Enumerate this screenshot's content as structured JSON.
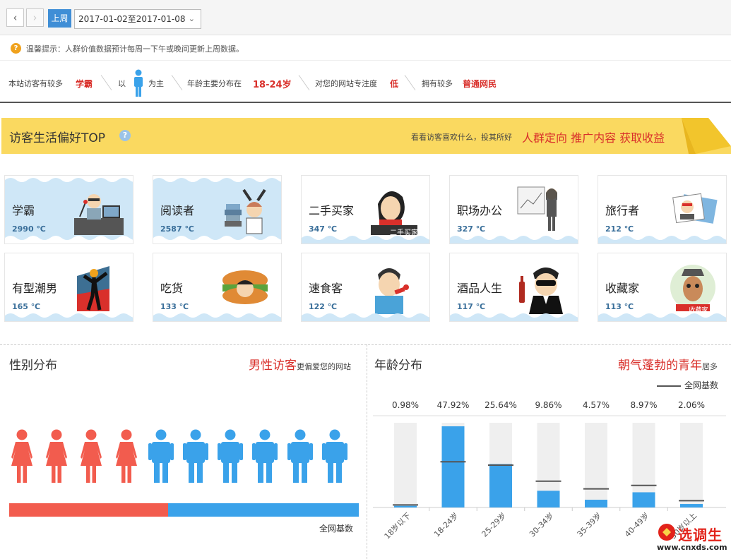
{
  "toolbar": {
    "prev_icon": "chevron-left-icon",
    "next_icon": "chevron-right-icon",
    "week_label": "上周",
    "date_range": "2017-01-02至2017-01-08"
  },
  "tip": {
    "icon": "warning-icon",
    "text": "温馨提示：人群价值数据预计每周一下午或晚间更新上周数据。"
  },
  "summary": {
    "part1": "本站访客有较多",
    "value1": "学霸",
    "part2": "以",
    "part3": "为主",
    "part4": "年龄主要分布在",
    "value4": "18-24岁",
    "part5": "对您的网站专注度",
    "value5": "低",
    "part6": "拥有较多",
    "value6": "普通网民"
  },
  "banner": {
    "title": "访客生活偏好TOP",
    "help_icon": "question-icon",
    "sub": "看看访客喜欢什么，投其所好",
    "highlight": "人群定向 推广内容 获取收益"
  },
  "cards": [
    {
      "name": "学霸",
      "temp": "2990 ℃",
      "icon": "scholar-icon",
      "highlighted": true
    },
    {
      "name": "阅读者",
      "temp": "2587 ℃",
      "icon": "reader-icon",
      "highlighted": true
    },
    {
      "name": "二手买家",
      "temp": "347 ℃",
      "icon": "second-hand-buyer-icon",
      "highlighted": false,
      "art_label": "二手买家"
    },
    {
      "name": "职场办公",
      "temp": "327 ℃",
      "icon": "office-worker-icon",
      "highlighted": false
    },
    {
      "name": "旅行者",
      "temp": "212 ℃",
      "icon": "traveler-icon",
      "highlighted": false
    },
    {
      "name": "有型潮男",
      "temp": "165 ℃",
      "icon": "trendy-man-icon",
      "highlighted": false
    },
    {
      "name": "吃货",
      "temp": "133 ℃",
      "icon": "foodie-icon",
      "highlighted": false
    },
    {
      "name": "速食客",
      "temp": "122 ℃",
      "icon": "fast-food-eater-icon",
      "highlighted": false
    },
    {
      "name": "酒品人生",
      "temp": "117 ℃",
      "icon": "wine-lover-icon",
      "highlighted": false
    },
    {
      "name": "收藏家",
      "temp": "113 ℃",
      "icon": "collector-icon",
      "highlighted": false,
      "art_label": "收藏家"
    }
  ],
  "gender": {
    "title": "性别分布",
    "note_highlight": "男性访客",
    "note_rest": "更偏爱您的网站",
    "baseline_label": "全网基数",
    "female_icons": 4,
    "male_icons": 6,
    "female_fraction": 0.455,
    "colors": {
      "female": "#f25c4e",
      "male": "#3aa2ea"
    }
  },
  "age": {
    "title": "年龄分布",
    "note_highlight": "朝气蓬勃的青年",
    "note_rest": "居多",
    "legend_label": "全网基数"
  },
  "chart_data": {
    "type": "bar",
    "categories": [
      "18岁以下",
      "18-24岁",
      "25-29岁",
      "30-34岁",
      "35-39岁",
      "40-49岁",
      "50岁以上"
    ],
    "values": [
      0.98,
      47.92,
      25.64,
      9.86,
      4.57,
      8.97,
      2.06
    ],
    "value_labels": [
      "0.98%",
      "47.92%",
      "25.64%",
      "9.86%",
      "4.57%",
      "8.97%",
      "2.06%"
    ],
    "baseline": [
      1.5,
      27.0,
      25.0,
      15.5,
      11.0,
      13.0,
      4.0
    ],
    "ylim": [
      0,
      50
    ],
    "colors": {
      "bar": "#3aa2ea",
      "track": "#efefef",
      "baseline": "#555555"
    }
  },
  "watermark": {
    "text": "选调生",
    "url": "www.cnxds.com"
  }
}
